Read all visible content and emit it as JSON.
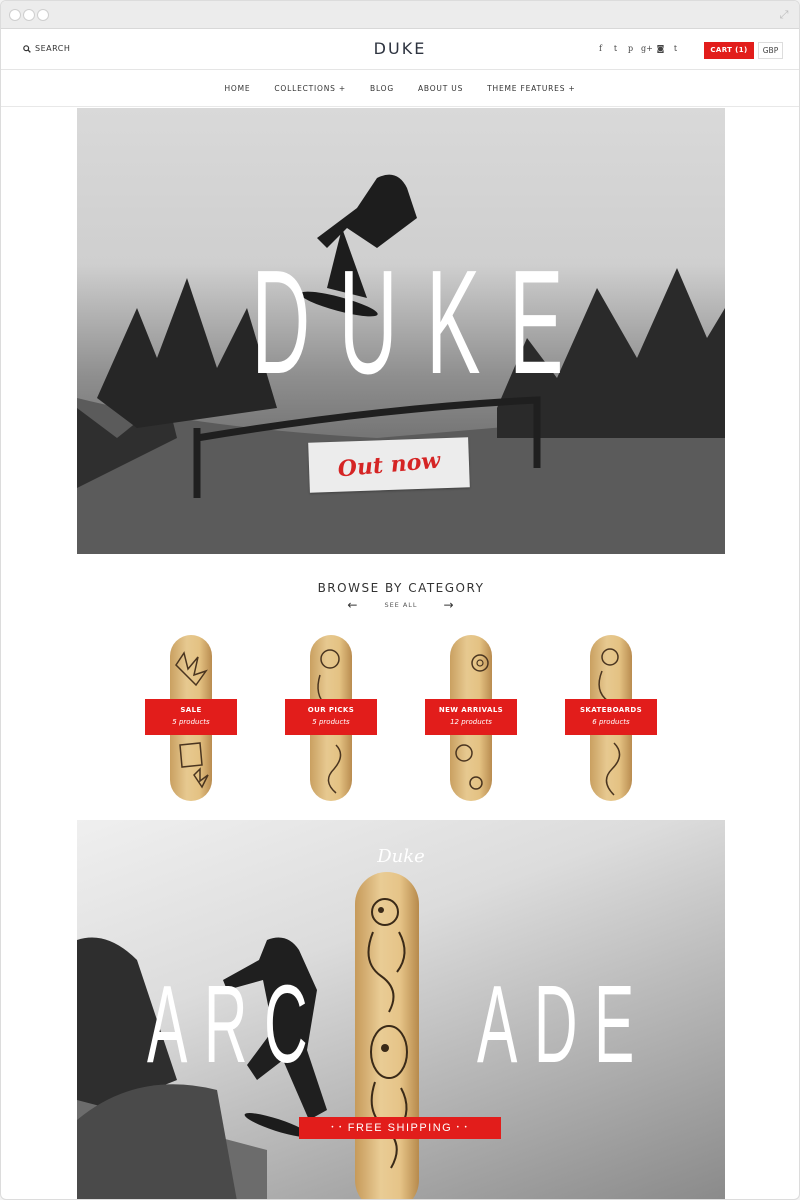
{
  "header": {
    "search_label": "SEARCH",
    "logo": "DUKE",
    "social": [
      "f",
      "t",
      "p",
      "g+",
      "ig",
      "t"
    ],
    "cart_label": "CART (1)",
    "currency": "GBP"
  },
  "nav": {
    "items": [
      "HOME",
      "COLLECTIONS +",
      "BLOG",
      "ABOUT US",
      "THEME FEATURES +"
    ]
  },
  "hero": {
    "title": "DUKE",
    "badge": "Out now"
  },
  "browse": {
    "heading": "BROWSE BY CATEGORY",
    "see_all": "SEE ALL",
    "prev_arrow": "←",
    "next_arrow": "→",
    "categories": [
      {
        "name": "SALE",
        "count": "5 products"
      },
      {
        "name": "OUR PICKS",
        "count": "5 products"
      },
      {
        "name": "NEW ARRIVALS",
        "count": "12 products"
      },
      {
        "name": "SKATEBOARDS",
        "count": "6 products"
      }
    ]
  },
  "promo": {
    "script_title": "Duke",
    "left_word": "ARC",
    "right_word": "ADE",
    "ribbon": "FREE SHIPPING",
    "ribbon_dots": "• •"
  },
  "colors": {
    "accent": "#e21d1b",
    "text": "#333333"
  }
}
